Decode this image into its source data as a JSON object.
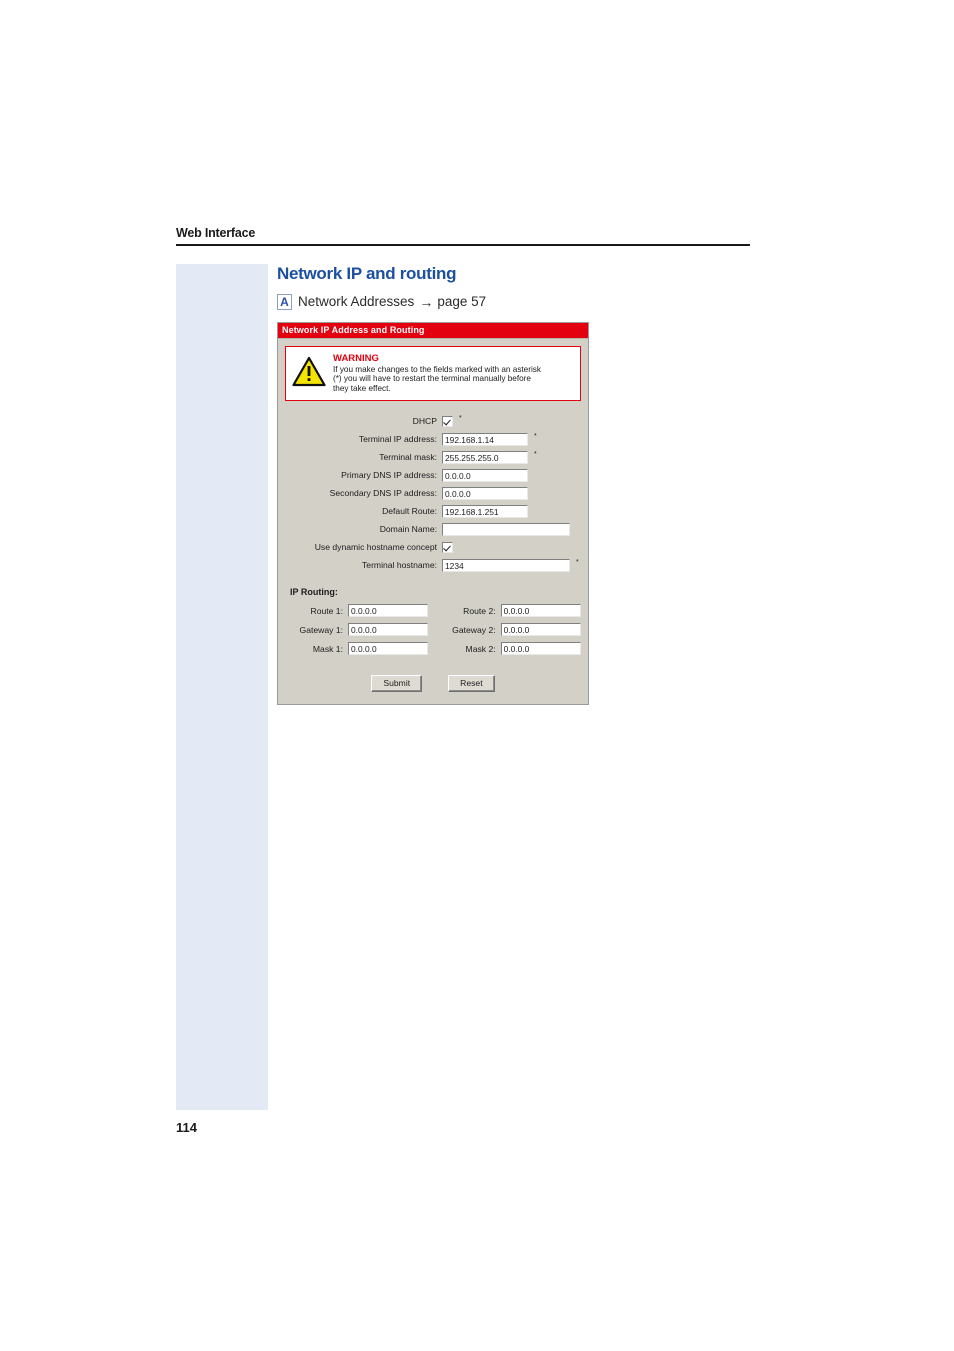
{
  "page": {
    "running_header": "Web Interface",
    "number": "114"
  },
  "section": {
    "title": "Network IP and routing",
    "xref": {
      "badge": "A",
      "label": "Network Addresses",
      "arrow": "→",
      "target": "page 57"
    }
  },
  "dialog": {
    "titlebar": "Network IP Address and Routing",
    "title_bg": "#e3000f",
    "body_bg": "#d3d0c8",
    "warning": {
      "icon": "warning-triangle-icon",
      "heading": "WARNING",
      "line1": "If you make changes to the fields marked with an asterisk",
      "line2": "(*) you will have to restart the terminal manually before",
      "line3": "they take effect.",
      "accent": "#e3000f"
    },
    "fields": [
      {
        "label": "DHCP",
        "type": "checkbox",
        "checked": true,
        "asterisk": "*"
      },
      {
        "label": "Terminal IP address:",
        "type": "text",
        "value": "192.168.1.14",
        "width": "std",
        "asterisk": "*"
      },
      {
        "label": "Terminal mask:",
        "type": "text",
        "value": "255.255.255.0",
        "width": "std",
        "asterisk": "*"
      },
      {
        "label": "Primary DNS IP address:",
        "type": "text",
        "value": "0.0.0.0",
        "width": "std",
        "asterisk": ""
      },
      {
        "label": "Secondary DNS IP address:",
        "type": "text",
        "value": "0.0.0.0",
        "width": "std",
        "asterisk": ""
      },
      {
        "label": "Default Route:",
        "type": "text",
        "value": "192.168.1.251",
        "width": "std",
        "asterisk": ""
      },
      {
        "label": "Domain Name:",
        "type": "text",
        "value": "",
        "width": "wide",
        "asterisk": ""
      },
      {
        "label": "Use dynamic hostname concept",
        "type": "checkbox",
        "checked": true,
        "asterisk": ""
      },
      {
        "label": "Terminal hostname:",
        "type": "text",
        "value": "1234",
        "width": "wide",
        "asterisk": "*"
      }
    ],
    "routing": {
      "heading": "IP Routing:",
      "rows": [
        {
          "label1": "Route 1:",
          "value1": "0.0.0.0",
          "label2": "Route 2:",
          "value2": "0.0.0.0"
        },
        {
          "label1": "Gateway 1:",
          "value1": "0.0.0.0",
          "label2": "Gateway 2:",
          "value2": "0.0.0.0"
        },
        {
          "label1": "Mask 1:",
          "value1": "0.0.0.0",
          "label2": "Mask 2:",
          "value2": "0.0.0.0"
        }
      ]
    },
    "buttons": {
      "submit": "Submit",
      "reset": "Reset"
    }
  }
}
